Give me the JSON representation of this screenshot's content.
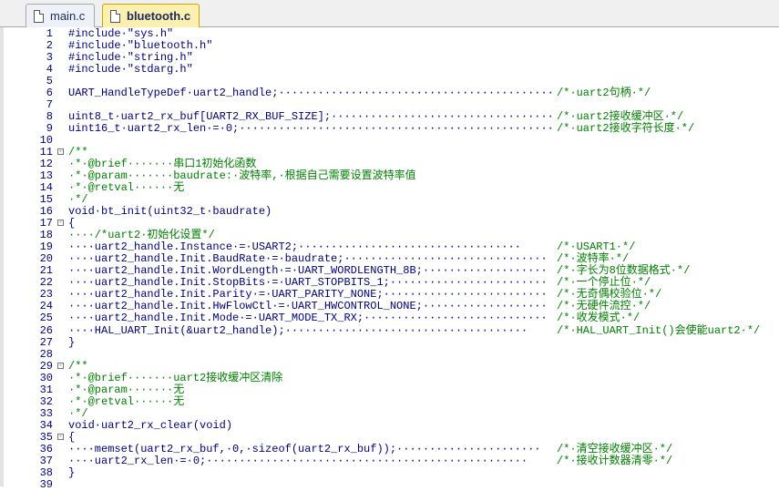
{
  "tabs": [
    {
      "label": "main.c",
      "active": false
    },
    {
      "label": "bluetooth.c",
      "active": true
    }
  ],
  "colors": {
    "code": "#000080",
    "comment": "#008000",
    "active_tab": "#fbf0b0"
  },
  "lines": [
    {
      "n": "1",
      "code": "#include·\"sys.h\"",
      "comment": ""
    },
    {
      "n": "2",
      "code": "#include·\"bluetooth.h\"",
      "comment": ""
    },
    {
      "n": "3",
      "code": "#include·\"string.h\"",
      "comment": ""
    },
    {
      "n": "4",
      "code": "#include·\"stdarg.h\"",
      "comment": ""
    },
    {
      "n": "5",
      "code": "",
      "comment": ""
    },
    {
      "n": "6",
      "code": "UART_HandleTypeDef·uart2_handle;·····················································",
      "comment": "/*·uart2句柄·*/"
    },
    {
      "n": "7",
      "code": "",
      "comment": ""
    },
    {
      "n": "8",
      "code": "uint8_t·uart2_rx_buf[UART2_RX_BUF_SIZE];······································",
      "comment": "/*·uart2接收缓冲区·*/"
    },
    {
      "n": "9",
      "code": "uint16_t·uart2_rx_len·=·0;·····················································",
      "comment": "/*·uart2接收字符长度·*/"
    },
    {
      "n": "10",
      "code": "",
      "comment": ""
    },
    {
      "n": "11",
      "code": "/**",
      "comment": "",
      "fold": "-",
      "green": true
    },
    {
      "n": "12",
      "code": "·*·@brief·······串口1初始化函数",
      "comment": "",
      "green": true
    },
    {
      "n": "13",
      "code": "·*·@param·······baudrate:·波特率,·根据自己需要设置波特率值",
      "comment": "",
      "green": true
    },
    {
      "n": "14",
      "code": "·*·@retval······无",
      "comment": "",
      "green": true
    },
    {
      "n": "15",
      "code": "·*/",
      "comment": "",
      "green": true
    },
    {
      "n": "16",
      "code": "void·bt_init(uint32_t·baudrate)",
      "comment": ""
    },
    {
      "n": "17",
      "code": "{",
      "comment": "",
      "fold": "-"
    },
    {
      "n": "18",
      "code": "····/*uart2·初始化设置*/",
      "comment": "",
      "green": true
    },
    {
      "n": "19",
      "code": "····uart2_handle.Instance·=·USART2;··································",
      "comment": "/*·USART1·*/"
    },
    {
      "n": "20",
      "code": "····uart2_handle.Init.BaudRate·=·baudrate;·······························",
      "comment": "/*·波特率·*/"
    },
    {
      "n": "21",
      "code": "····uart2_handle.Init.WordLength·=·UART_WORDLENGTH_8B;···················",
      "comment": "/*·字长为8位数据格式·*/"
    },
    {
      "n": "22",
      "code": "····uart2_handle.Init.StopBits·=·UART_STOPBITS_1;························",
      "comment": "/*·一个停止位·*/"
    },
    {
      "n": "23",
      "code": "····uart2_handle.Init.Parity·=·UART_PARITY_NONE;·························",
      "comment": "/*·无奇偶校验位·*/"
    },
    {
      "n": "24",
      "code": "····uart2_handle.Init.HwFlowCtl·=·UART_HWCONTROL_NONE;···················",
      "comment": "/*·无硬件流控·*/"
    },
    {
      "n": "25",
      "code": "····uart2_handle.Init.Mode·=·UART_MODE_TX_RX;····························",
      "comment": "/*·收发模式·*/"
    },
    {
      "n": "26",
      "code": "····HAL_UART_Init(&uart2_handle);·····································",
      "comment": "/*·HAL_UART_Init()会使能uart2·*/"
    },
    {
      "n": "27",
      "code": "}",
      "comment": ""
    },
    {
      "n": "28",
      "code": "",
      "comment": ""
    },
    {
      "n": "29",
      "code": "/**",
      "comment": "",
      "fold": "-",
      "green": true
    },
    {
      "n": "30",
      "code": "·*·@brief·······uart2接收缓冲区清除",
      "comment": "",
      "green": true
    },
    {
      "n": "31",
      "code": "·*·@param·······无",
      "comment": "",
      "green": true
    },
    {
      "n": "32",
      "code": "·*·@retval······无",
      "comment": "",
      "green": true
    },
    {
      "n": "33",
      "code": "·*/",
      "comment": "",
      "green": true
    },
    {
      "n": "34",
      "code": "void·uart2_rx_clear(void)",
      "comment": ""
    },
    {
      "n": "35",
      "code": "{",
      "comment": "",
      "fold": "-"
    },
    {
      "n": "36",
      "code": "····memset(uart2_rx_buf,·0,·sizeof(uart2_rx_buf));······················",
      "comment": "/*·清空接收缓冲区·*/"
    },
    {
      "n": "37",
      "code": "····uart2_rx_len·=·0;·················································",
      "comment": "/*·接收计数器清零·*/"
    },
    {
      "n": "38",
      "code": "}",
      "comment": ""
    },
    {
      "n": "39",
      "code": "",
      "comment": ""
    }
  ]
}
